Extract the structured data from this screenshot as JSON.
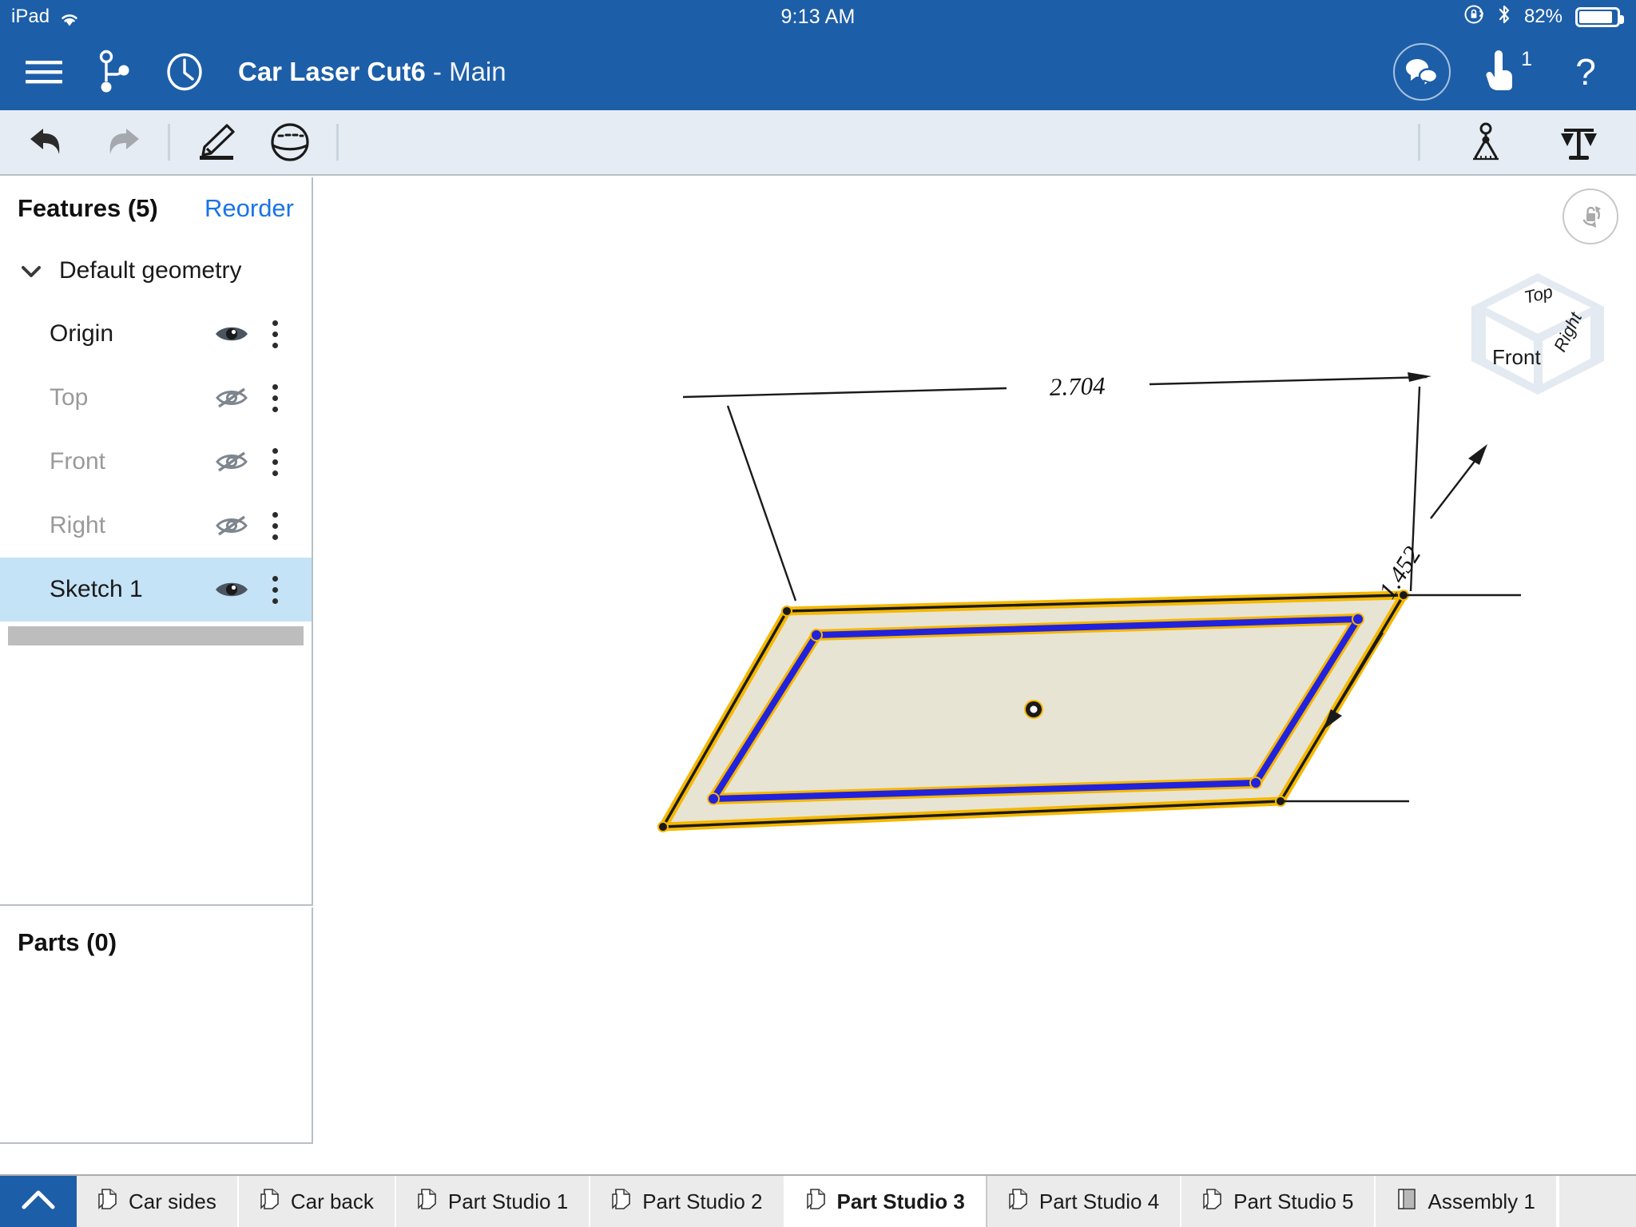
{
  "status_bar": {
    "device": "iPad",
    "wifi_icon": "wifi-icon",
    "time": "9:13 AM",
    "rotation_lock_icon": "rotation-lock-icon",
    "bluetooth_icon": "bluetooth-icon",
    "battery_percent": "82%",
    "battery_icon": "battery-icon"
  },
  "title_bar": {
    "menu_icon": "hamburger-menu-icon",
    "branch_icon": "branch-version-icon",
    "history_icon": "history-clock-icon",
    "document_name": "Car Laser Cut6",
    "separator": " - ",
    "workspace": "Main",
    "comments_icon": "comments-icon",
    "follow_icon": "hand-pointer-icon",
    "follow_badge": "1",
    "help_icon": "help-question-icon",
    "bg_color": "#1d5ea8"
  },
  "toolbar": {
    "undo_icon": "undo-arrow-icon",
    "redo_icon": "redo-arrow-icon",
    "sketch_icon": "sketch-pencil-icon",
    "surface_icon": "sphere-surface-icon",
    "measure_icon": "compass-measure-icon",
    "mass_icon": "balance-scale-icon",
    "bg_color": "#e5ecf3"
  },
  "features_panel": {
    "title": "Features (5)",
    "reorder_label": "Reorder",
    "group": {
      "label": "Default geometry",
      "expanded_icon": "chevron-down-icon"
    },
    "items": [
      {
        "label": "Origin",
        "visible": true,
        "visibility_icon": "eye-visible-icon",
        "menu_icon": "kebab-menu-icon",
        "selected": false
      },
      {
        "label": "Top",
        "visible": false,
        "visibility_icon": "eye-hidden-icon",
        "menu_icon": "kebab-menu-icon",
        "selected": false
      },
      {
        "label": "Front",
        "visible": false,
        "visibility_icon": "eye-hidden-icon",
        "menu_icon": "kebab-menu-icon",
        "selected": false
      },
      {
        "label": "Right",
        "visible": false,
        "visibility_icon": "eye-hidden-icon",
        "menu_icon": "kebab-menu-icon",
        "selected": false
      },
      {
        "label": "Sketch 1",
        "visible": true,
        "visibility_icon": "eye-visible-icon",
        "menu_icon": "kebab-menu-icon",
        "selected": true
      }
    ],
    "selected_highlight_color": "#c5e3f6",
    "rollback_bar": "rollback-bar"
  },
  "parts_panel": {
    "title": "Parts (0)"
  },
  "panel_collapse": {
    "icon": "chevron-left-icon"
  },
  "viewport": {
    "view_lock_icon": "rotation-lock-view-icon",
    "view_cube": {
      "top_label": "Top",
      "front_label": "Front",
      "right_label": "Right"
    },
    "sketch": {
      "horizontal_dimension": "2.704",
      "vertical_dimension": "1.452",
      "origin_point": "sketch-origin-point",
      "selected_edge_color": "#2222dd",
      "highlight_color": "#f5b800",
      "face_fill": "#e8e4d4"
    }
  },
  "tab_bar": {
    "home_icon": "chevron-up-icon",
    "tabs": [
      {
        "label": "Car sides",
        "icon": "part-studio-icon",
        "active": false
      },
      {
        "label": "Car back",
        "icon": "part-studio-icon",
        "active": false
      },
      {
        "label": "Part Studio 1",
        "icon": "part-studio-icon",
        "active": false
      },
      {
        "label": "Part Studio 2",
        "icon": "part-studio-icon",
        "active": false
      },
      {
        "label": "Part Studio 3",
        "icon": "part-studio-icon",
        "active": true
      },
      {
        "label": "Part Studio 4",
        "icon": "part-studio-icon",
        "active": false
      },
      {
        "label": "Part Studio 5",
        "icon": "part-studio-icon",
        "active": false
      },
      {
        "label": "Assembly 1",
        "icon": "assembly-icon",
        "active": false
      }
    ]
  }
}
